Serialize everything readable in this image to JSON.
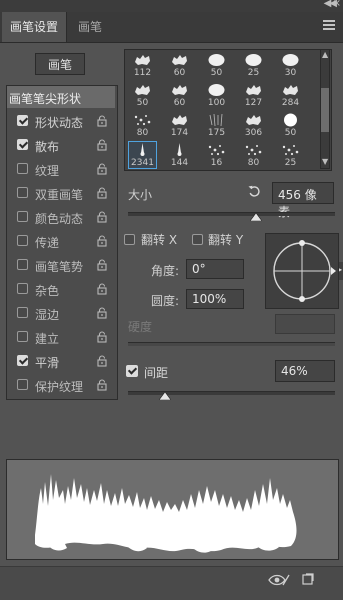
{
  "tabs": [
    {
      "label": "画笔设置",
      "active": true
    },
    {
      "label": "画笔",
      "active": false
    }
  ],
  "presets_button": "画笔",
  "categories": [
    {
      "label": "画笔笔尖形状",
      "header": true
    },
    {
      "label": "形状动态",
      "checked": true
    },
    {
      "label": "散布",
      "checked": true
    },
    {
      "label": "纹理",
      "checked": false
    },
    {
      "label": "双重画笔",
      "checked": false
    },
    {
      "label": "颜色动态",
      "checked": false
    },
    {
      "label": "传递",
      "checked": false
    },
    {
      "label": "画笔笔势",
      "checked": false
    },
    {
      "label": "杂色",
      "checked": false
    },
    {
      "label": "湿边",
      "checked": false
    },
    {
      "label": "建立",
      "checked": false
    },
    {
      "label": "平滑",
      "checked": true
    },
    {
      "label": "保护纹理",
      "checked": false
    }
  ],
  "brushes": [
    {
      "size": "112",
      "kind": "splat"
    },
    {
      "size": "60",
      "kind": "splat"
    },
    {
      "size": "50",
      "kind": "blob"
    },
    {
      "size": "25",
      "kind": "blob"
    },
    {
      "size": "30",
      "kind": "blob"
    },
    {
      "size": "50",
      "kind": "splat"
    },
    {
      "size": "60",
      "kind": "splat"
    },
    {
      "size": "100",
      "kind": "blob"
    },
    {
      "size": "127",
      "kind": "splat"
    },
    {
      "size": "284",
      "kind": "splat"
    },
    {
      "size": "80",
      "kind": "dots"
    },
    {
      "size": "174",
      "kind": "splat"
    },
    {
      "size": "175",
      "kind": "hair"
    },
    {
      "size": "306",
      "kind": "splat"
    },
    {
      "size": "50",
      "kind": "round"
    },
    {
      "size": "2341",
      "kind": "spike",
      "selected": true
    },
    {
      "size": "144",
      "kind": "spike"
    },
    {
      "size": "16",
      "kind": "dots"
    },
    {
      "size": "80",
      "kind": "dots"
    },
    {
      "size": "25",
      "kind": "dots"
    }
  ],
  "size": {
    "label": "大小",
    "value": "456 像素",
    "slider": 0.62
  },
  "flip_x": {
    "label": "翻转 X",
    "checked": false
  },
  "flip_y": {
    "label": "翻转 Y",
    "checked": false
  },
  "angle": {
    "label": "角度:",
    "value": "0°"
  },
  "roundness": {
    "label": "圆度:",
    "value": "100%"
  },
  "hardness": {
    "label": "硬度"
  },
  "spacing": {
    "label": "间距",
    "value": "46%",
    "checked": true,
    "slider": 0.18
  },
  "colors": {
    "panel": "#535353",
    "accent": "#4fa3e0"
  },
  "icons": [
    "reset-icon",
    "lock-icon",
    "eye-icon",
    "new-brush-icon",
    "panel-menu-icon"
  ]
}
